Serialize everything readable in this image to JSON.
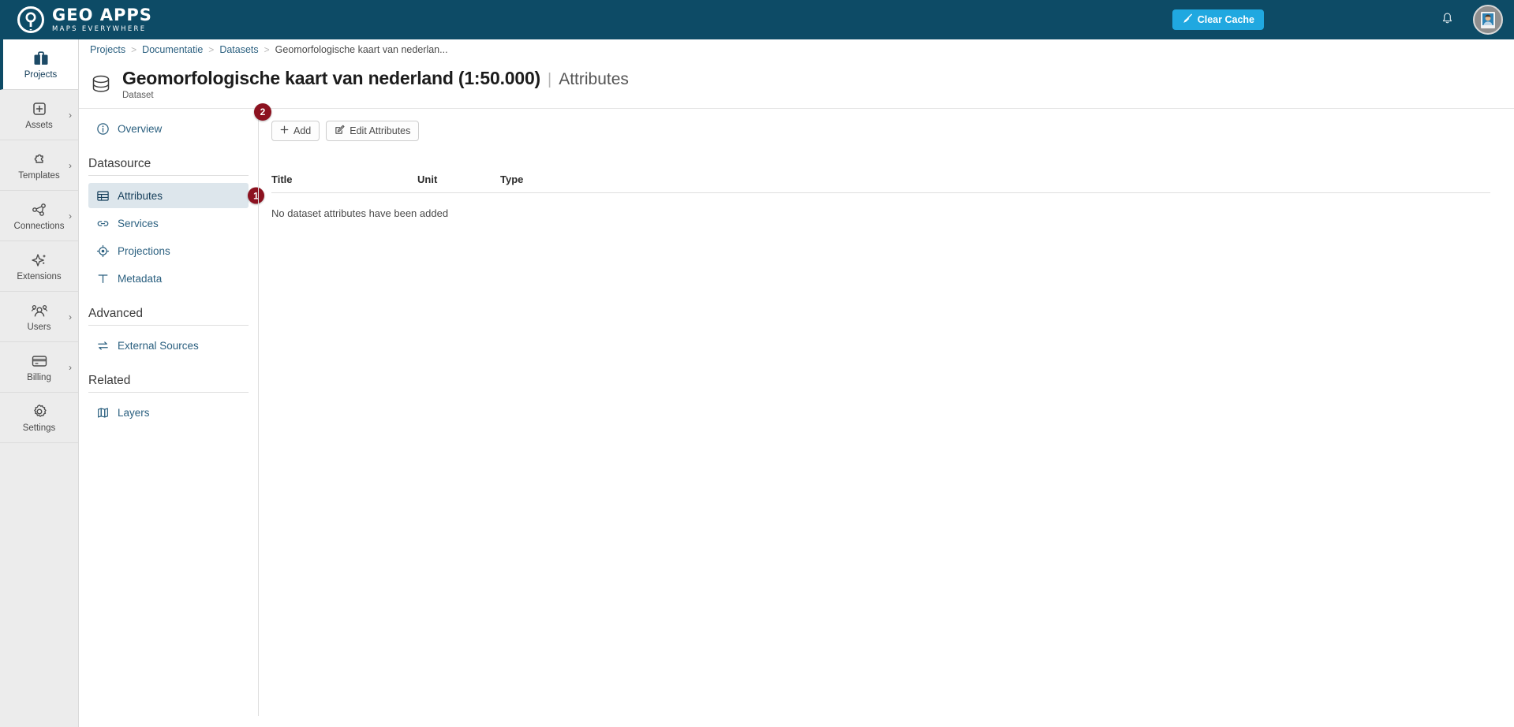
{
  "brand": {
    "title": "GEO APPS",
    "tagline": "MAPS EVERYWHERE",
    "logo_icon": "map-pin-location-icon",
    "header_color": "#0d4b66"
  },
  "topbar": {
    "clear_cache_label": "Clear Cache",
    "clear_cache_icon": "broom-icon",
    "clear_cache_color": "#20a8e0",
    "notifications_icon": "bell-icon",
    "avatar_icon": "user-photo-avatar"
  },
  "rail": {
    "items": [
      {
        "label": "Projects",
        "icon": "briefcase-icon",
        "active": true,
        "chevron": false
      },
      {
        "label": "Assets",
        "icon": "plus-square-icon",
        "active": false,
        "chevron": true
      },
      {
        "label": "Templates",
        "icon": "puzzle-icon",
        "active": false,
        "chevron": true
      },
      {
        "label": "Connections",
        "icon": "nodes-graph-icon",
        "active": false,
        "chevron": true
      },
      {
        "label": "Extensions",
        "icon": "sparkle-icon",
        "active": false,
        "chevron": false
      },
      {
        "label": "Users",
        "icon": "users-group-icon",
        "active": false,
        "chevron": true
      },
      {
        "label": "Billing",
        "icon": "credit-card-icon",
        "active": false,
        "chevron": true
      },
      {
        "label": "Settings",
        "icon": "gear-icon",
        "active": false,
        "chevron": false
      }
    ]
  },
  "breadcrumb": {
    "items": [
      "Projects",
      "Documentatie",
      "Datasets",
      "Geomorfologische kaart van nederlan..."
    ],
    "separator": ">"
  },
  "page_header": {
    "icon": "database-cylinder-icon",
    "title": "Geomorfologische kaart van nederland (1:50.000)",
    "divider": "|",
    "section": "Attributes",
    "subtitle": "Dataset"
  },
  "navpanel": {
    "overview": {
      "label": "Overview",
      "icon": "info-circle-icon"
    },
    "groups": [
      {
        "title": "Datasource",
        "items": [
          {
            "label": "Attributes",
            "icon": "table-grid-icon",
            "active": true,
            "badge": "1"
          },
          {
            "label": "Services",
            "icon": "link-chain-icon",
            "active": false,
            "badge": null
          },
          {
            "label": "Projections",
            "icon": "crosshair-icon",
            "active": false,
            "badge": null
          },
          {
            "label": "Metadata",
            "icon": "text-t-icon",
            "active": false,
            "badge": null
          }
        ]
      },
      {
        "title": "Advanced",
        "items": [
          {
            "label": "External Sources",
            "icon": "exchange-arrows-icon",
            "active": false,
            "badge": null
          }
        ]
      },
      {
        "title": "Related",
        "items": [
          {
            "label": "Layers",
            "icon": "layers-map-icon",
            "active": false,
            "badge": null
          }
        ]
      }
    ],
    "badge_color": "#8c1220"
  },
  "toolbar": {
    "add_label": "Add",
    "add_icon": "plus-icon",
    "edit_label": "Edit Attributes",
    "edit_icon": "pencil-square-icon",
    "add_badge": "2"
  },
  "table": {
    "headers": {
      "title": "Title",
      "unit": "Unit",
      "type": "Type"
    },
    "rows": [],
    "empty_message": "No dataset attributes have been added"
  }
}
